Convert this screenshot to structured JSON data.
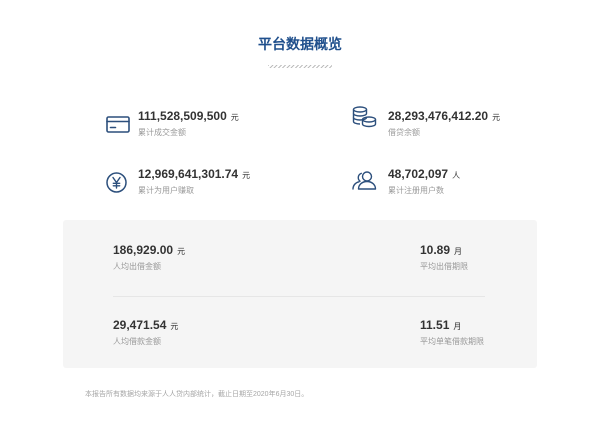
{
  "title": "平台数据概览",
  "stats": [
    {
      "value": "111,528,509,500",
      "unit": "元",
      "label": "累计成交金额",
      "icon": "credit-card-icon"
    },
    {
      "value": "28,293,476,412.20",
      "unit": "元",
      "label": "借贷余额",
      "icon": "coins-icon"
    },
    {
      "value": "12,969,641,301.74",
      "unit": "元",
      "label": "累计为用户赚取",
      "icon": "yen-icon"
    },
    {
      "value": "48,702,097",
      "unit": "人",
      "label": "累计注册用户数",
      "icon": "users-icon"
    }
  ],
  "averages": [
    {
      "value": "186,929.00",
      "unit": "元",
      "label": "人均出借金额"
    },
    {
      "value": "10.89",
      "unit": "月",
      "label": "平均出借期限"
    },
    {
      "value": "29,471.54",
      "unit": "元",
      "label": "人均借款金额"
    },
    {
      "value": "11.51",
      "unit": "月",
      "label": "平均单笔借款期限"
    }
  ],
  "footer": "本报告所有数据均来源于人人贷内部统计，截止日期至2020年6月30日。",
  "colors": {
    "accent": "#1f4f8c",
    "icon": "#2c4f7c",
    "text": "#333333",
    "muted": "#999999",
    "panel": "#f5f5f5"
  }
}
